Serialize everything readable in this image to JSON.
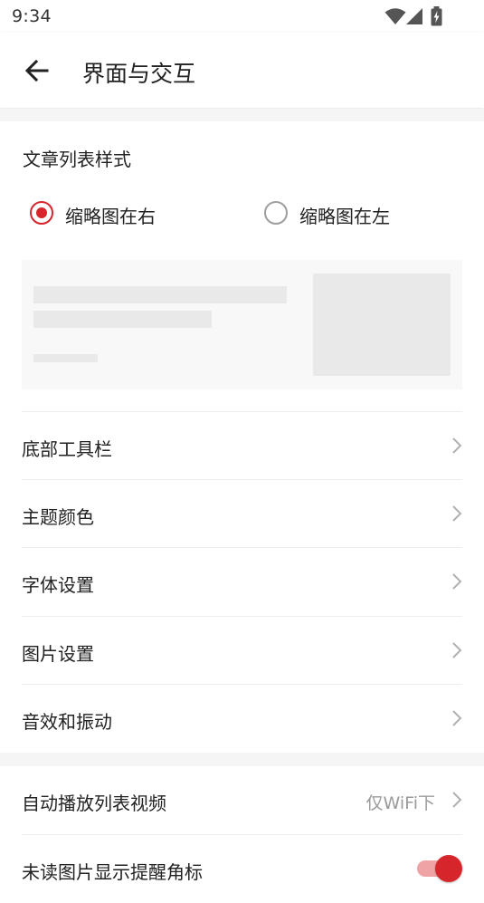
{
  "status_bar": {
    "time": "9:34",
    "icons": [
      "wifi-icon",
      "signal-icon",
      "battery-charging-icon"
    ]
  },
  "toolbar": {
    "back_icon": "arrow-left-icon",
    "title": "界面与交互"
  },
  "article_list_style": {
    "label": "文章列表样式",
    "options": [
      {
        "label": "缩略图在右",
        "selected": true
      },
      {
        "label": "缩略图在左",
        "selected": false
      }
    ]
  },
  "settings_rows": [
    {
      "label": "底部工具栏"
    },
    {
      "label": "主题颜色"
    },
    {
      "label": "字体设置"
    },
    {
      "label": "图片设置"
    },
    {
      "label": "音效和振动"
    }
  ],
  "second_group": [
    {
      "label": "自动播放列表视频",
      "value": "仅WiFi下"
    },
    {
      "label": "未读图片显示提醒角标",
      "toggle_on": true
    }
  ],
  "colors": {
    "accent": "#d7262b",
    "divider": "#eeeeee",
    "section_gap": "#f5f5f5",
    "placeholder": "#e9e9e9"
  }
}
